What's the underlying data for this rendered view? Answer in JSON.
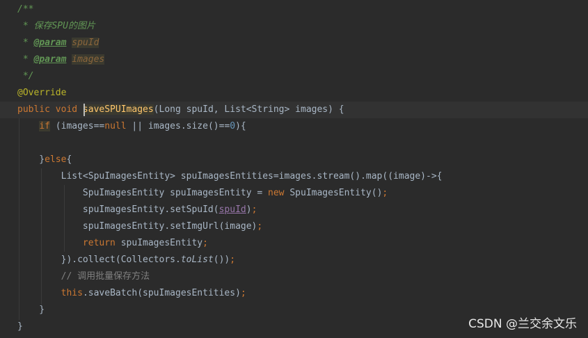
{
  "code_lines": [
    {
      "tokens": [
        {
          "t": "/**",
          "c": "doc"
        }
      ]
    },
    {
      "tokens": [
        {
          "t": " * 保存SPU的图片",
          "c": "doc"
        }
      ]
    },
    {
      "tokens": [
        {
          "t": " * ",
          "c": "doc"
        },
        {
          "t": "@param",
          "c": "tag"
        },
        {
          "t": " ",
          "c": "doc"
        },
        {
          "t": "spuId",
          "c": "param"
        }
      ]
    },
    {
      "tokens": [
        {
          "t": " * ",
          "c": "doc"
        },
        {
          "t": "@param",
          "c": "tag"
        },
        {
          "t": " ",
          "c": "doc"
        },
        {
          "t": "images",
          "c": "param"
        }
      ]
    },
    {
      "tokens": [
        {
          "t": " */",
          "c": "doc"
        }
      ]
    },
    {
      "tokens": [
        {
          "t": "@Override",
          "c": "ann"
        }
      ]
    },
    {
      "tokens": [
        {
          "t": "public void ",
          "c": "kw"
        },
        {
          "t": "saveSPUImages",
          "c": "method"
        },
        {
          "t": "(Long spuId, List<String> images) {",
          "c": "plain"
        }
      ]
    },
    {
      "tokens": [
        {
          "t": "    ",
          "c": "plain"
        },
        {
          "t": "if",
          "c": "kwhl"
        },
        {
          "t": " (images==",
          "c": "plain"
        },
        {
          "t": "null",
          "c": "kw"
        },
        {
          "t": " || images.size()==",
          "c": "plain"
        },
        {
          "t": "0",
          "c": "num"
        },
        {
          "t": "){",
          "c": "plain"
        }
      ]
    },
    {
      "tokens": []
    },
    {
      "tokens": [
        {
          "t": "    }",
          "c": "plain"
        },
        {
          "t": "else",
          "c": "kw"
        },
        {
          "t": "{",
          "c": "plain"
        }
      ]
    },
    {
      "tokens": [
        {
          "t": "        List<SpuImagesEntity> spuImagesEntities=images.stream().map((image)->{",
          "c": "plain"
        }
      ]
    },
    {
      "tokens": [
        {
          "t": "            SpuImagesEntity spuImagesEntity = ",
          "c": "plain"
        },
        {
          "t": "new ",
          "c": "kw"
        },
        {
          "t": "SpuImagesEntity()",
          "c": "plain"
        },
        {
          "t": ";",
          "c": "kw"
        }
      ]
    },
    {
      "tokens": [
        {
          "t": "            spuImagesEntity.setSpuId(",
          "c": "plain"
        },
        {
          "t": "spuId",
          "c": "field"
        },
        {
          "t": ")",
          "c": "plain"
        },
        {
          "t": ";",
          "c": "kw"
        }
      ]
    },
    {
      "tokens": [
        {
          "t": "            spuImagesEntity.setImgUrl(image)",
          "c": "plain"
        },
        {
          "t": ";",
          "c": "kw"
        }
      ]
    },
    {
      "tokens": [
        {
          "t": "            ",
          "c": "plain"
        },
        {
          "t": "return ",
          "c": "kw"
        },
        {
          "t": "spuImagesEntity",
          "c": "plain"
        },
        {
          "t": ";",
          "c": "kw"
        }
      ]
    },
    {
      "tokens": [
        {
          "t": "        }).collect(Collectors.",
          "c": "plain"
        },
        {
          "t": "toList",
          "c": "static"
        },
        {
          "t": "())",
          "c": "plain"
        },
        {
          "t": ";",
          "c": "kw"
        }
      ]
    },
    {
      "tokens": [
        {
          "t": "        ",
          "c": "plain"
        },
        {
          "t": "// 调用批量保存方法",
          "c": "comment"
        }
      ]
    },
    {
      "tokens": [
        {
          "t": "        ",
          "c": "plain"
        },
        {
          "t": "this",
          "c": "kw"
        },
        {
          "t": ".saveBatch(spuImagesEntities)",
          "c": "plain"
        },
        {
          "t": ";",
          "c": "kw"
        }
      ]
    },
    {
      "tokens": [
        {
          "t": "    }",
          "c": "plain"
        }
      ]
    },
    {
      "tokens": [
        {
          "t": "}",
          "c": "plain"
        }
      ]
    }
  ],
  "watermark": "CSDN @兰交余文乐"
}
